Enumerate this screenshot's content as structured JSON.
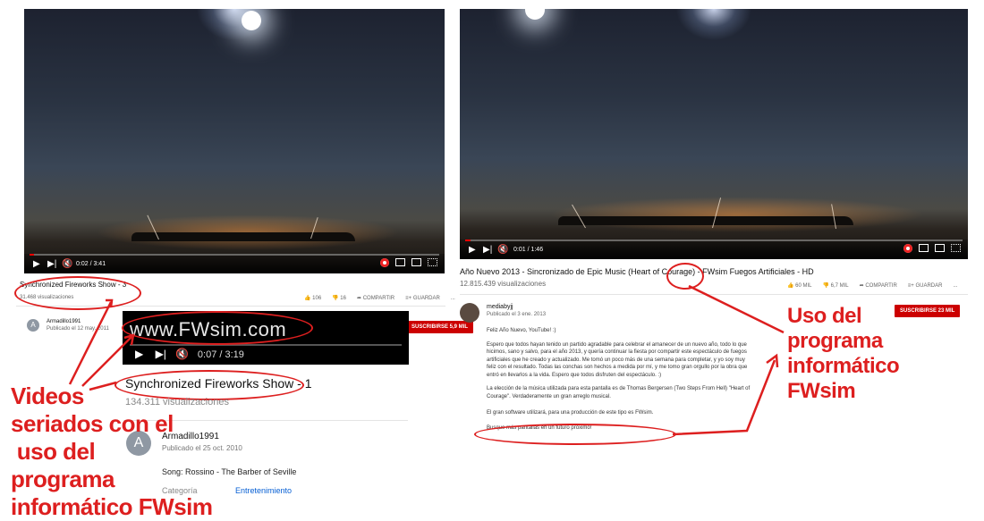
{
  "left": {
    "player": {
      "time": "0:02 / 3:41"
    },
    "title": "Synchronized Fireworks Show - 3",
    "views": "31.468 visualizaciones",
    "likes": "106",
    "dislikes": "16",
    "share": "COMPARTIR",
    "save": "GUARDAR",
    "more": "...",
    "channel": "Armadillo1991",
    "published": "Publicado el 12 may. 2011",
    "subscribe": "SUSCRIBIRSE 5,9 MIL"
  },
  "zoom": {
    "url": "www.FWsim.com",
    "time": "0:07 / 3:19",
    "title": "Synchronized Fireworks Show - 1",
    "views": "134.311 visualizaciones",
    "avatar_letter": "A",
    "channel": "Armadillo1991",
    "published": "Publicado el 25 oct. 2010",
    "song": "Song: Rossino - The Barber of Seville",
    "category_label": "Categoría",
    "category_value": "Entretenimiento"
  },
  "right": {
    "player": {
      "time": "0:01 / 1:46"
    },
    "title": "Año Nuevo 2013 - Sincronizado de Epic Music (Heart of Courage) - FWsim Fuegos Artificiales - HD",
    "views": "12.815.439 visualizaciones",
    "likes": "60 MIL",
    "dislikes": "6,7 MIL",
    "share": "COMPARTIR",
    "save": "GUARDAR",
    "more": "...",
    "channel": "mediabyjj",
    "published": "Publicado el 3 ene. 2013",
    "subscribe": "SUSCRIBIRSE 23 MIL",
    "description": [
      "Feliz Año Nuevo, YouTube! :)",
      "Espero que todos hayan tenido un partido agradable para celebrar el amanecer de un nuevo año, todo lo que hicimos, sano y salvo, para el año 2013, y quería continuar la fiesta por compartir este espectáculo de fuegos artificiales que he creado y actualizado. Me tomó un poco más de una semana para completar, y yo soy muy feliz con el resultado. Todas las conchas son hechos a medida por mí, y me tomo gran orgullo por la obra que entró en llevarlos a la vida. Espero que todos disfruten del espectáculo. :)",
      "La elección de la música utilizada para esta pantalla es de Thomas Bergersen (Two Steps From Hell) \"Heart of Courage\". Verdaderamente un gran arreglo musical.",
      "El gran software utilizará, para una producción de este tipo es FWsim.",
      "Busque más pantallas en un futuro próximo!"
    ]
  },
  "annotations": {
    "left_lines": [
      "Videos",
      "seriados con el",
      " uso del",
      "programa",
      "informático FWsim"
    ],
    "right_lines": [
      "Uso del",
      "programa",
      "informático",
      "FWsim"
    ]
  },
  "colors": {
    "accent_red": "#dd1f1f",
    "subscribe_red": "#cc0000",
    "link_blue": "#065fd4"
  }
}
